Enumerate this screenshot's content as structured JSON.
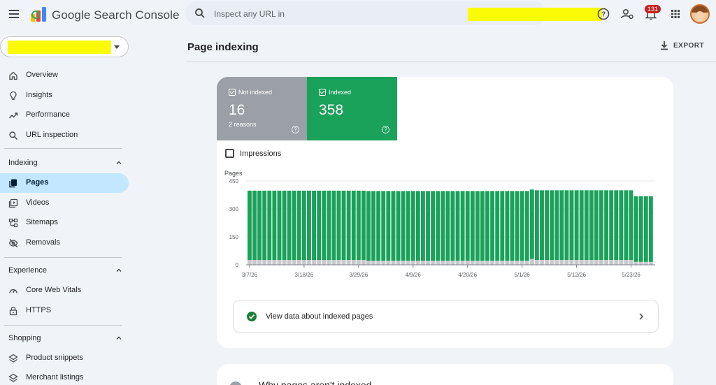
{
  "app": {
    "brand": "Google Search Console",
    "search_placeholder": "Inspect any URL in",
    "notification_count": "131"
  },
  "sidebar": {
    "top_items": [
      {
        "label": "Overview",
        "icon": "home-icon"
      },
      {
        "label": "Insights",
        "icon": "lightbulb-icon"
      },
      {
        "label": "Performance",
        "icon": "trending-up-icon"
      },
      {
        "label": "URL inspection",
        "icon": "search-icon"
      }
    ],
    "sections": [
      {
        "title": "Indexing",
        "items": [
          {
            "label": "Pages",
            "icon": "pages-icon",
            "active": true
          },
          {
            "label": "Videos",
            "icon": "video-icon"
          },
          {
            "label": "Sitemaps",
            "icon": "sitemap-icon"
          },
          {
            "label": "Removals",
            "icon": "eye-off-icon"
          }
        ]
      },
      {
        "title": "Experience",
        "items": [
          {
            "label": "Core Web Vitals",
            "icon": "gauge-icon"
          },
          {
            "label": "HTTPS",
            "icon": "lock-icon"
          }
        ]
      },
      {
        "title": "Shopping",
        "items": [
          {
            "label": "Product snippets",
            "icon": "layers-icon"
          },
          {
            "label": "Merchant listings",
            "icon": "layers-icon"
          }
        ]
      }
    ]
  },
  "main": {
    "title": "Page indexing",
    "export_label": "EXPORT",
    "not_indexed": {
      "label": "Not indexed",
      "value": "16",
      "sub": "2 reasons"
    },
    "indexed": {
      "label": "Indexed",
      "value": "358"
    },
    "impressions_label": "Impressions",
    "view_data_label": "View data about indexed pages",
    "next_card_text": "Why pages aren't indexed"
  },
  "colors": {
    "indexed": "#1aa15a",
    "not_indexed": "#9aa0a6",
    "active_nav": "#c2e7ff",
    "background": "#f0f4f9"
  },
  "chart_data": {
    "type": "bar",
    "stacked": true,
    "ylabel": "Pages",
    "ylim": [
      0,
      450
    ],
    "yticks": [
      0,
      150,
      300,
      450
    ],
    "xticks": [
      "3/7/26",
      "3/18/26",
      "3/29/26",
      "4/9/26",
      "4/20/26",
      "5/1/26",
      "5/12/26",
      "5/23/26"
    ],
    "tick_every": 11,
    "series": [
      {
        "name": "Indexed",
        "values": [
          372,
          372,
          372,
          372,
          372,
          372,
          372,
          372,
          372,
          372,
          372,
          372,
          372,
          372,
          372,
          372,
          372,
          372,
          372,
          372,
          372,
          372,
          372,
          372,
          374,
          374,
          374,
          374,
          374,
          374,
          374,
          374,
          374,
          374,
          374,
          374,
          374,
          374,
          374,
          374,
          374,
          374,
          374,
          374,
          374,
          374,
          374,
          374,
          374,
          374,
          374,
          374,
          374,
          374,
          374,
          374,
          374,
          372,
          374,
          374,
          374,
          374,
          374,
          374,
          374,
          374,
          374,
          374,
          374,
          374,
          374,
          374,
          374,
          374,
          374,
          374,
          374,
          374,
          352,
          352,
          352,
          352
        ]
      },
      {
        "name": "Not indexed",
        "values": [
          26,
          26,
          26,
          26,
          26,
          26,
          26,
          26,
          26,
          26,
          26,
          26,
          26,
          26,
          26,
          26,
          26,
          26,
          26,
          26,
          26,
          26,
          26,
          26,
          22,
          22,
          22,
          22,
          22,
          22,
          22,
          22,
          22,
          22,
          22,
          22,
          22,
          22,
          22,
          22,
          22,
          22,
          22,
          22,
          22,
          22,
          22,
          22,
          22,
          22,
          22,
          22,
          22,
          22,
          22,
          22,
          22,
          32,
          26,
          26,
          26,
          26,
          26,
          26,
          26,
          26,
          26,
          26,
          26,
          26,
          26,
          26,
          26,
          26,
          26,
          26,
          26,
          26,
          16,
          16,
          16,
          16
        ]
      }
    ]
  }
}
